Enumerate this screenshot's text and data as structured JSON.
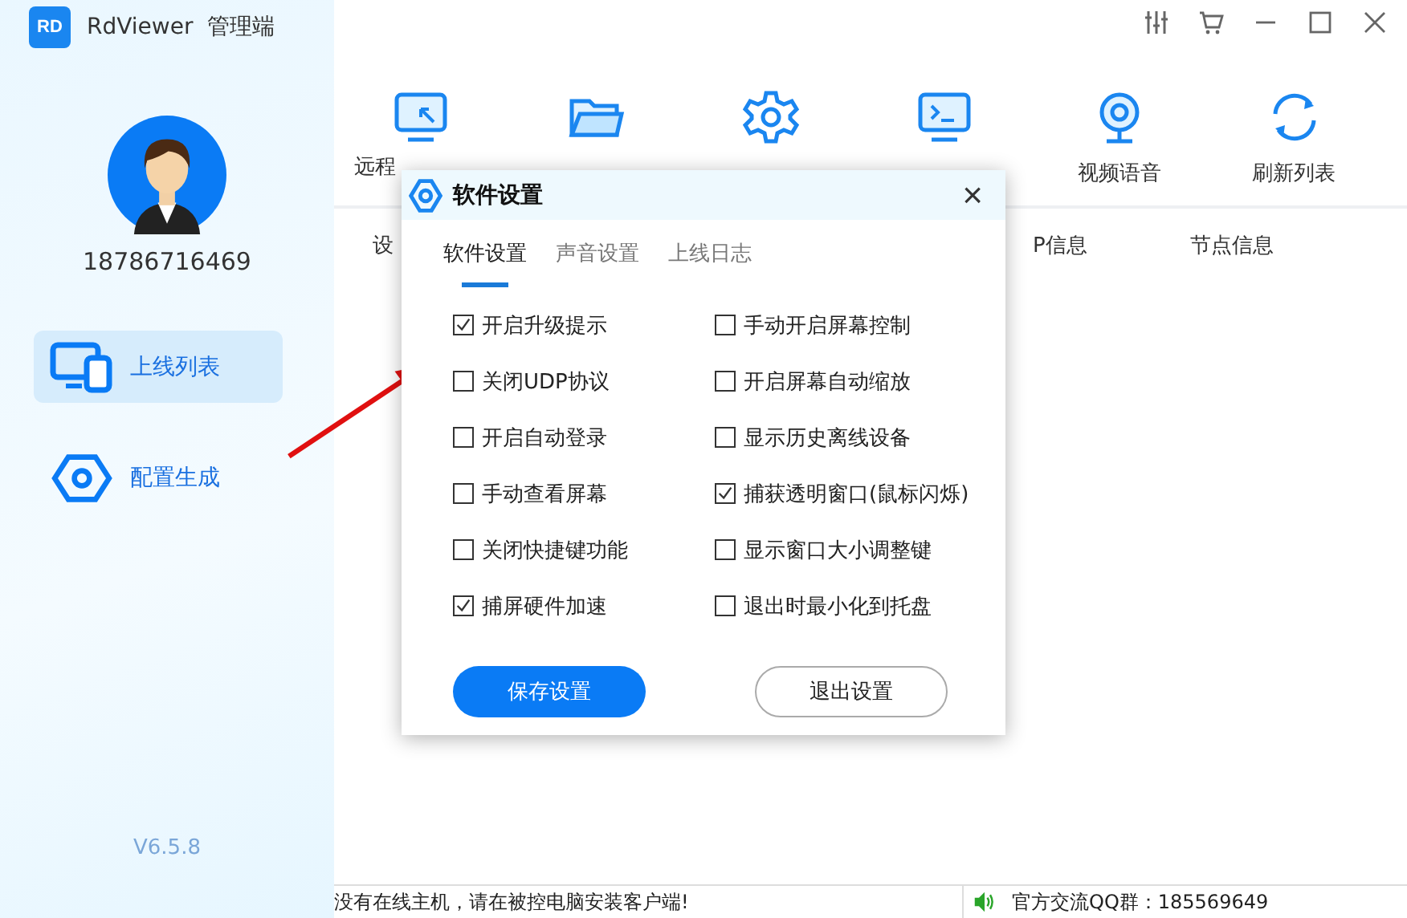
{
  "app": {
    "logo": "RD",
    "title": "RdViewer  管理端",
    "version": "V6.5.8"
  },
  "user": {
    "phone": "18786716469"
  },
  "sidebar": {
    "items": [
      {
        "label": "上线列表",
        "selected": true
      },
      {
        "label": "配置生成",
        "selected": false
      }
    ]
  },
  "toolbar": {
    "labels": [
      "远程",
      "视频语音",
      "刷新列表"
    ]
  },
  "table": {
    "columns": [
      "设",
      "P信息",
      "节点信息"
    ]
  },
  "status_bar": {
    "message": "没有在线主机，请在被控电脑安装客户端!",
    "qq": "官方交流QQ群：185569649"
  },
  "dialog": {
    "title": "软件设置",
    "close": "×",
    "tabs": [
      {
        "label": "软件设置",
        "selected": true
      },
      {
        "label": "声音设置",
        "selected": false
      },
      {
        "label": "上线日志",
        "selected": false
      }
    ],
    "options": [
      {
        "label": "开启升级提示",
        "checked": true
      },
      {
        "label": "手动开启屏幕控制",
        "checked": false
      },
      {
        "label": "关闭UDP协议",
        "checked": false
      },
      {
        "label": "开启屏幕自动缩放",
        "checked": false
      },
      {
        "label": "开启自动登录",
        "checked": false
      },
      {
        "label": "显示历史离线设备",
        "checked": false
      },
      {
        "label": "手动查看屏幕",
        "checked": false
      },
      {
        "label": "捕获透明窗口(鼠标闪烁)",
        "checked": true
      },
      {
        "label": "关闭快捷键功能",
        "checked": false
      },
      {
        "label": "显示窗口大小调整键",
        "checked": false
      },
      {
        "label": "捕屏硬件加速",
        "checked": true
      },
      {
        "label": "退出时最小化到托盘",
        "checked": false
      }
    ],
    "buttons": [
      {
        "label": "保存设置",
        "kind": "primary"
      },
      {
        "label": "退出设置",
        "kind": "secondary"
      }
    ]
  }
}
